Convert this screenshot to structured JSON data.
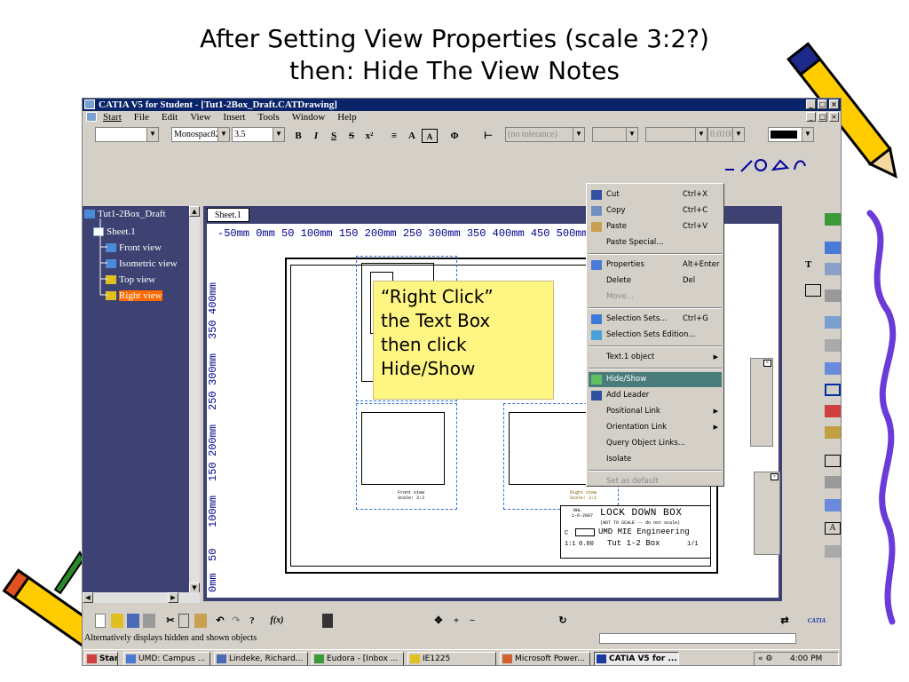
{
  "slide": {
    "title_line1": "After Setting View Properties (scale 3:2?)",
    "title_line2": "then: Hide The View Notes"
  },
  "window": {
    "title": "CATIA V5 for Student - [Tut1-2Box_Draft.CATDrawing]",
    "menu": [
      "Start",
      "File",
      "Edit",
      "View",
      "Insert",
      "Tools",
      "Window",
      "Help"
    ]
  },
  "toolbar": {
    "font_name": "Monospac821 B",
    "font_size": "3.5",
    "tolerance": "(no tolerance)",
    "precision": "0.01000"
  },
  "tree": {
    "root": "Tut1-2Box_Draft",
    "sheet": "Sheet.1",
    "views": [
      "Front view",
      "Isometric view",
      "Top view",
      "Right view"
    ],
    "selected": "Right view"
  },
  "sheet_tab": "Sheet.1",
  "ruler": {
    "horizontal": "-50mm  0mm   50   100mm  150  200mm  250  300mm  350  400mm  450  500mm  550  600mm",
    "vertical": [
      "0mm",
      "50",
      "100mm",
      "150",
      "200mm",
      "250",
      "300mm",
      "350",
      "400mm"
    ]
  },
  "drawing": {
    "front_view_label": "Front view",
    "front_view_scale": "Scale: 3:2",
    "right_view_label": "Right view",
    "right_view_scale": "Scale: 3:2",
    "titleblock": {
      "drawn_by": "RHL",
      "date": "1-6-2007",
      "title": "LOCK DOWN BOX",
      "note": "(NOT TO SCALE -- do not scale)",
      "company": "UMD MIE Engineering",
      "size": "C",
      "part": "Tut 1-2 Box",
      "sheet": "1/1",
      "scale": "1:1",
      "weight": "0.00"
    }
  },
  "callout": {
    "lines": [
      "“Right Click”",
      "the Text Box",
      "then click",
      "Hide/Show"
    ]
  },
  "context_menu": {
    "items": [
      {
        "label": "Cut",
        "shortcut": "Ctrl+X",
        "icon": "scissors-icon"
      },
      {
        "label": "Copy",
        "shortcut": "Ctrl+C",
        "icon": "copy-icon"
      },
      {
        "label": "Paste",
        "shortcut": "Ctrl+V",
        "icon": "paste-icon"
      },
      {
        "label": "Paste Special...",
        "shortcut": ""
      },
      {
        "label": "Properties",
        "shortcut": "Alt+Enter",
        "icon": "properties-icon"
      },
      {
        "label": "Delete",
        "shortcut": "Del"
      },
      {
        "label": "Move...",
        "shortcut": "",
        "disabled": true
      },
      {
        "label": "Selection Sets...",
        "shortcut": "Ctrl+G",
        "icon": "selection-sets-icon"
      },
      {
        "label": "Selection Sets Edition...",
        "shortcut": "",
        "icon": "selection-sets-edition-icon"
      },
      {
        "label": "Text.1 object",
        "shortcut": "",
        "submenu": true
      },
      {
        "label": "Hide/Show",
        "shortcut": "",
        "icon": "hide-show-icon",
        "highlighted": true
      },
      {
        "label": "Add Leader",
        "shortcut": "",
        "icon": "add-leader-icon"
      },
      {
        "label": "Positional Link",
        "shortcut": "",
        "submenu": true
      },
      {
        "label": "Orientation Link",
        "shortcut": "",
        "submenu": true
      },
      {
        "label": "Query Object Links...",
        "shortcut": ""
      },
      {
        "label": "Isolate",
        "shortcut": ""
      },
      {
        "label": "Set as default",
        "shortcut": "",
        "disabled": true
      }
    ]
  },
  "status_bar": {
    "message": "Alternatively displays hidden and shown objects"
  },
  "taskbar": {
    "start": "Start",
    "tasks": [
      "UMD: Campus ...",
      "Lindeke, Richard...",
      "Eudora - [Inbox ...",
      "IE1225",
      "Microsoft Power...",
      "CATIA V5 for ..."
    ],
    "active_task": "CATIA V5 for ...",
    "clock": "4:00 PM"
  },
  "colors": {
    "title_bar": "#0a246a",
    "tree_bg": "#3d4272",
    "callout_bg": "#fff582",
    "selection": "#ff6a00",
    "menu_highlight": "#4a7c7c"
  }
}
